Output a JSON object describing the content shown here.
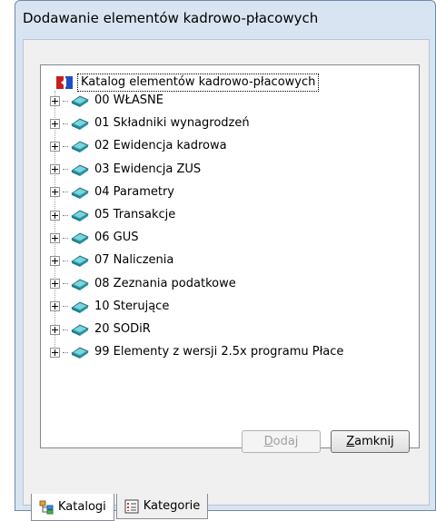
{
  "window": {
    "title": "Dodawanie elementów kadrowo-płacowych"
  },
  "tree": {
    "root_label": "Katalog elementów kadrowo-płacowych",
    "items": [
      "00 WŁASNE",
      "01 Składniki wynagrodzeń",
      "02 Ewidencja kadrowa",
      "03 Ewidencja ZUS",
      "04 Parametry",
      "05 Transakcje",
      "06 GUS",
      "07 Naliczenia",
      "08 Zeznania podatkowe",
      "10 Sterujące",
      "20 SODiR",
      "99 Elementy z wersji 2.5x programu Płace"
    ]
  },
  "buttons": {
    "add_accel": "D",
    "add_rest": "odaj",
    "close_accel": "Z",
    "close_rest": "amknij"
  },
  "tabs": {
    "catalogs": "Katalogi",
    "categories": "Kategorie"
  }
}
